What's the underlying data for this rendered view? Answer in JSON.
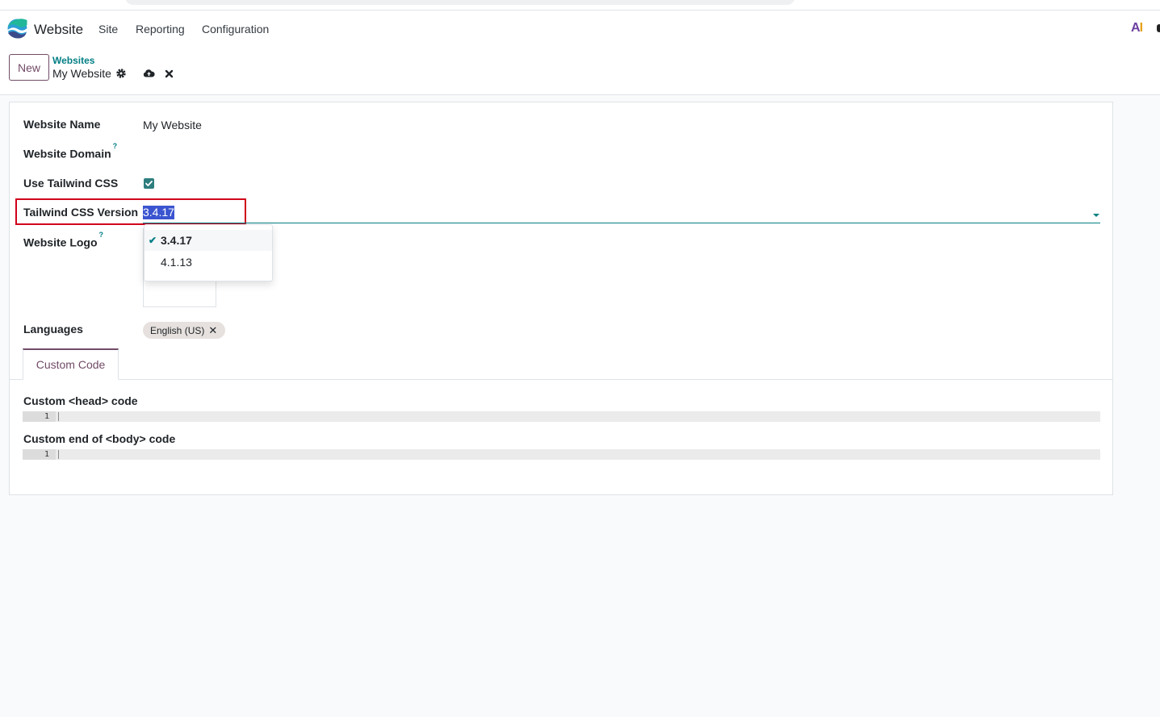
{
  "navbar": {
    "app_name": "Website",
    "menu": [
      "Site",
      "Reporting",
      "Configuration"
    ],
    "ai_logo": {
      "a": "A",
      "i": "I"
    }
  },
  "control": {
    "new_label": "New",
    "breadcrumb_parent": "Websites",
    "breadcrumb_current": "My Website"
  },
  "form": {
    "website_name_label": "Website Name",
    "website_name_value": "My Website",
    "website_domain_label": "Website Domain",
    "help_mark": "?",
    "tailwind_label": "Use Tailwind CSS",
    "tailwind_checked": true,
    "tailwind_version_label": "Tailwind CSS Version",
    "tailwind_version_value": "3.4.17",
    "website_logo_label": "Website Logo",
    "languages_label": "Languages",
    "languages": [
      "English (US)"
    ]
  },
  "dropdown": {
    "options": [
      "3.4.17",
      "4.1.13"
    ],
    "selected": "3.4.17"
  },
  "tabs": {
    "custom_code": "Custom Code"
  },
  "code": {
    "head_label": "Custom <head> code",
    "body_label": "Custom end of <body> code",
    "line_number": "1"
  },
  "colors": {
    "brand": "#714b67",
    "accent": "#017e84",
    "highlight_box": "#d0021b"
  }
}
